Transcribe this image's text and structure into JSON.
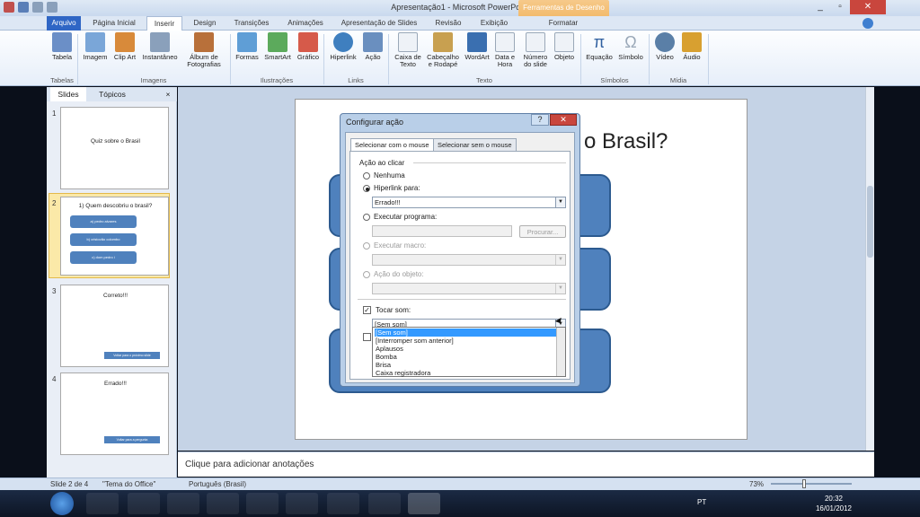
{
  "window": {
    "title": "Apresentação1 - Microsoft PowerPoint",
    "context_tab": "Ferramentas de Desenho"
  },
  "tabs": [
    "Arquivo",
    "Página Inicial",
    "Inserir",
    "Design",
    "Transições",
    "Animações",
    "Apresentação de Slides",
    "Revisão",
    "Exibição",
    "Formatar"
  ],
  "ribbon": {
    "buttons": [
      {
        "label": "Tabela",
        "icon": "table-icon",
        "color": "#6b8fc7"
      },
      {
        "label": "Imagem",
        "icon": "picture-icon",
        "color": "#7aa6d8"
      },
      {
        "label": "Clip Art",
        "icon": "clipart-icon",
        "color": "#d88a3a"
      },
      {
        "label": "Instantâneo",
        "icon": "screenshot-icon",
        "color": "#8aa0bb"
      },
      {
        "label": "Álbum de Fotografias",
        "icon": "photo-album-icon",
        "color": "#b8703a"
      },
      {
        "label": "Formas",
        "icon": "shapes-icon",
        "color": "#5f9ed6"
      },
      {
        "label": "SmartArt",
        "icon": "smartart-icon",
        "color": "#5caa5c"
      },
      {
        "label": "Gráfico",
        "icon": "chart-icon",
        "color": "#d65a4a"
      },
      {
        "label": "Hiperlink",
        "icon": "hyperlink-icon",
        "color": "#3f7fbf"
      },
      {
        "label": "Ação",
        "icon": "action-icon",
        "color": "#6a8fbf"
      },
      {
        "label": "Caixa de Texto",
        "icon": "textbox-icon",
        "color": "#9aa8b8"
      },
      {
        "label": "Cabeçalho e Rodapé",
        "icon": "header-footer-icon",
        "color": "#c8a050"
      },
      {
        "label": "WordArt",
        "icon": "wordart-icon",
        "color": "#3a6fb0"
      },
      {
        "label": "Data e Hora",
        "icon": "date-time-icon",
        "color": "#8aa0bb"
      },
      {
        "label": "Número do slide",
        "icon": "slide-number-icon",
        "color": "#8aa0bb"
      },
      {
        "label": "Objeto",
        "icon": "object-icon",
        "color": "#8aa0bb"
      },
      {
        "label": "Equação",
        "icon": "equation-icon",
        "color": "#2f5f9f"
      },
      {
        "label": "Símbolo",
        "icon": "symbol-icon",
        "color": "#9aa8b8"
      },
      {
        "label": "Vídeo",
        "icon": "video-icon",
        "color": "#5a7fa7"
      },
      {
        "label": "Áudio",
        "icon": "audio-icon",
        "color": "#d8a030"
      }
    ],
    "groups": [
      "Tabelas",
      "Imagens",
      "Ilustrações",
      "Links",
      "Texto",
      "Símbolos",
      "Mídia"
    ]
  },
  "panel": {
    "tabs": [
      "Slides",
      "Tópicos"
    ],
    "close": "×"
  },
  "thumbnails": [
    {
      "num": "1",
      "title": "Quiz sobre o Brasil"
    },
    {
      "num": "2",
      "title": "1) Quem descobriu o brasil?",
      "buttons": [
        "a) pedro alvares",
        "b) cristovão colombo",
        "c) dom pedro i"
      ]
    },
    {
      "num": "3",
      "title": "Correto!!!",
      "arrow": "Voltar para o próximo slide"
    },
    {
      "num": "4",
      "title": "Errado!!!",
      "arrow": "Voltar para a pergunta"
    }
  ],
  "slide": {
    "title_visible": "o Brasil?"
  },
  "dialog": {
    "title": "Configurar ação",
    "tabs": [
      "Selecionar com o mouse",
      "Selecionar sem o mouse"
    ],
    "section": "Ação ao clicar",
    "options": {
      "none": "Nenhuma",
      "hyperlink": "Hiperlink para:",
      "hyperlink_value": "Errado!!!",
      "run_program": "Executar programa:",
      "browse": "Procurar...",
      "run_macro": "Executar macro:",
      "object_action": "Ação do objeto:"
    },
    "play_sound": "Tocar som:",
    "sound_value": "[Sem som]",
    "sound_options": [
      "[Sem som]",
      "[Interromper som anterior]",
      "Aplausos",
      "Bomba",
      "Brisa",
      "Caixa registradora"
    ]
  },
  "notes": {
    "placeholder": "Clique para adicionar anotações"
  },
  "status": {
    "slide": "Slide 2 de 4",
    "theme": "\"Tema do Office\"",
    "language": "Português (Brasil)",
    "zoom": "73%"
  },
  "taskbar": {
    "lang": "PT",
    "time": "20:32",
    "date": "16/01/2012"
  }
}
